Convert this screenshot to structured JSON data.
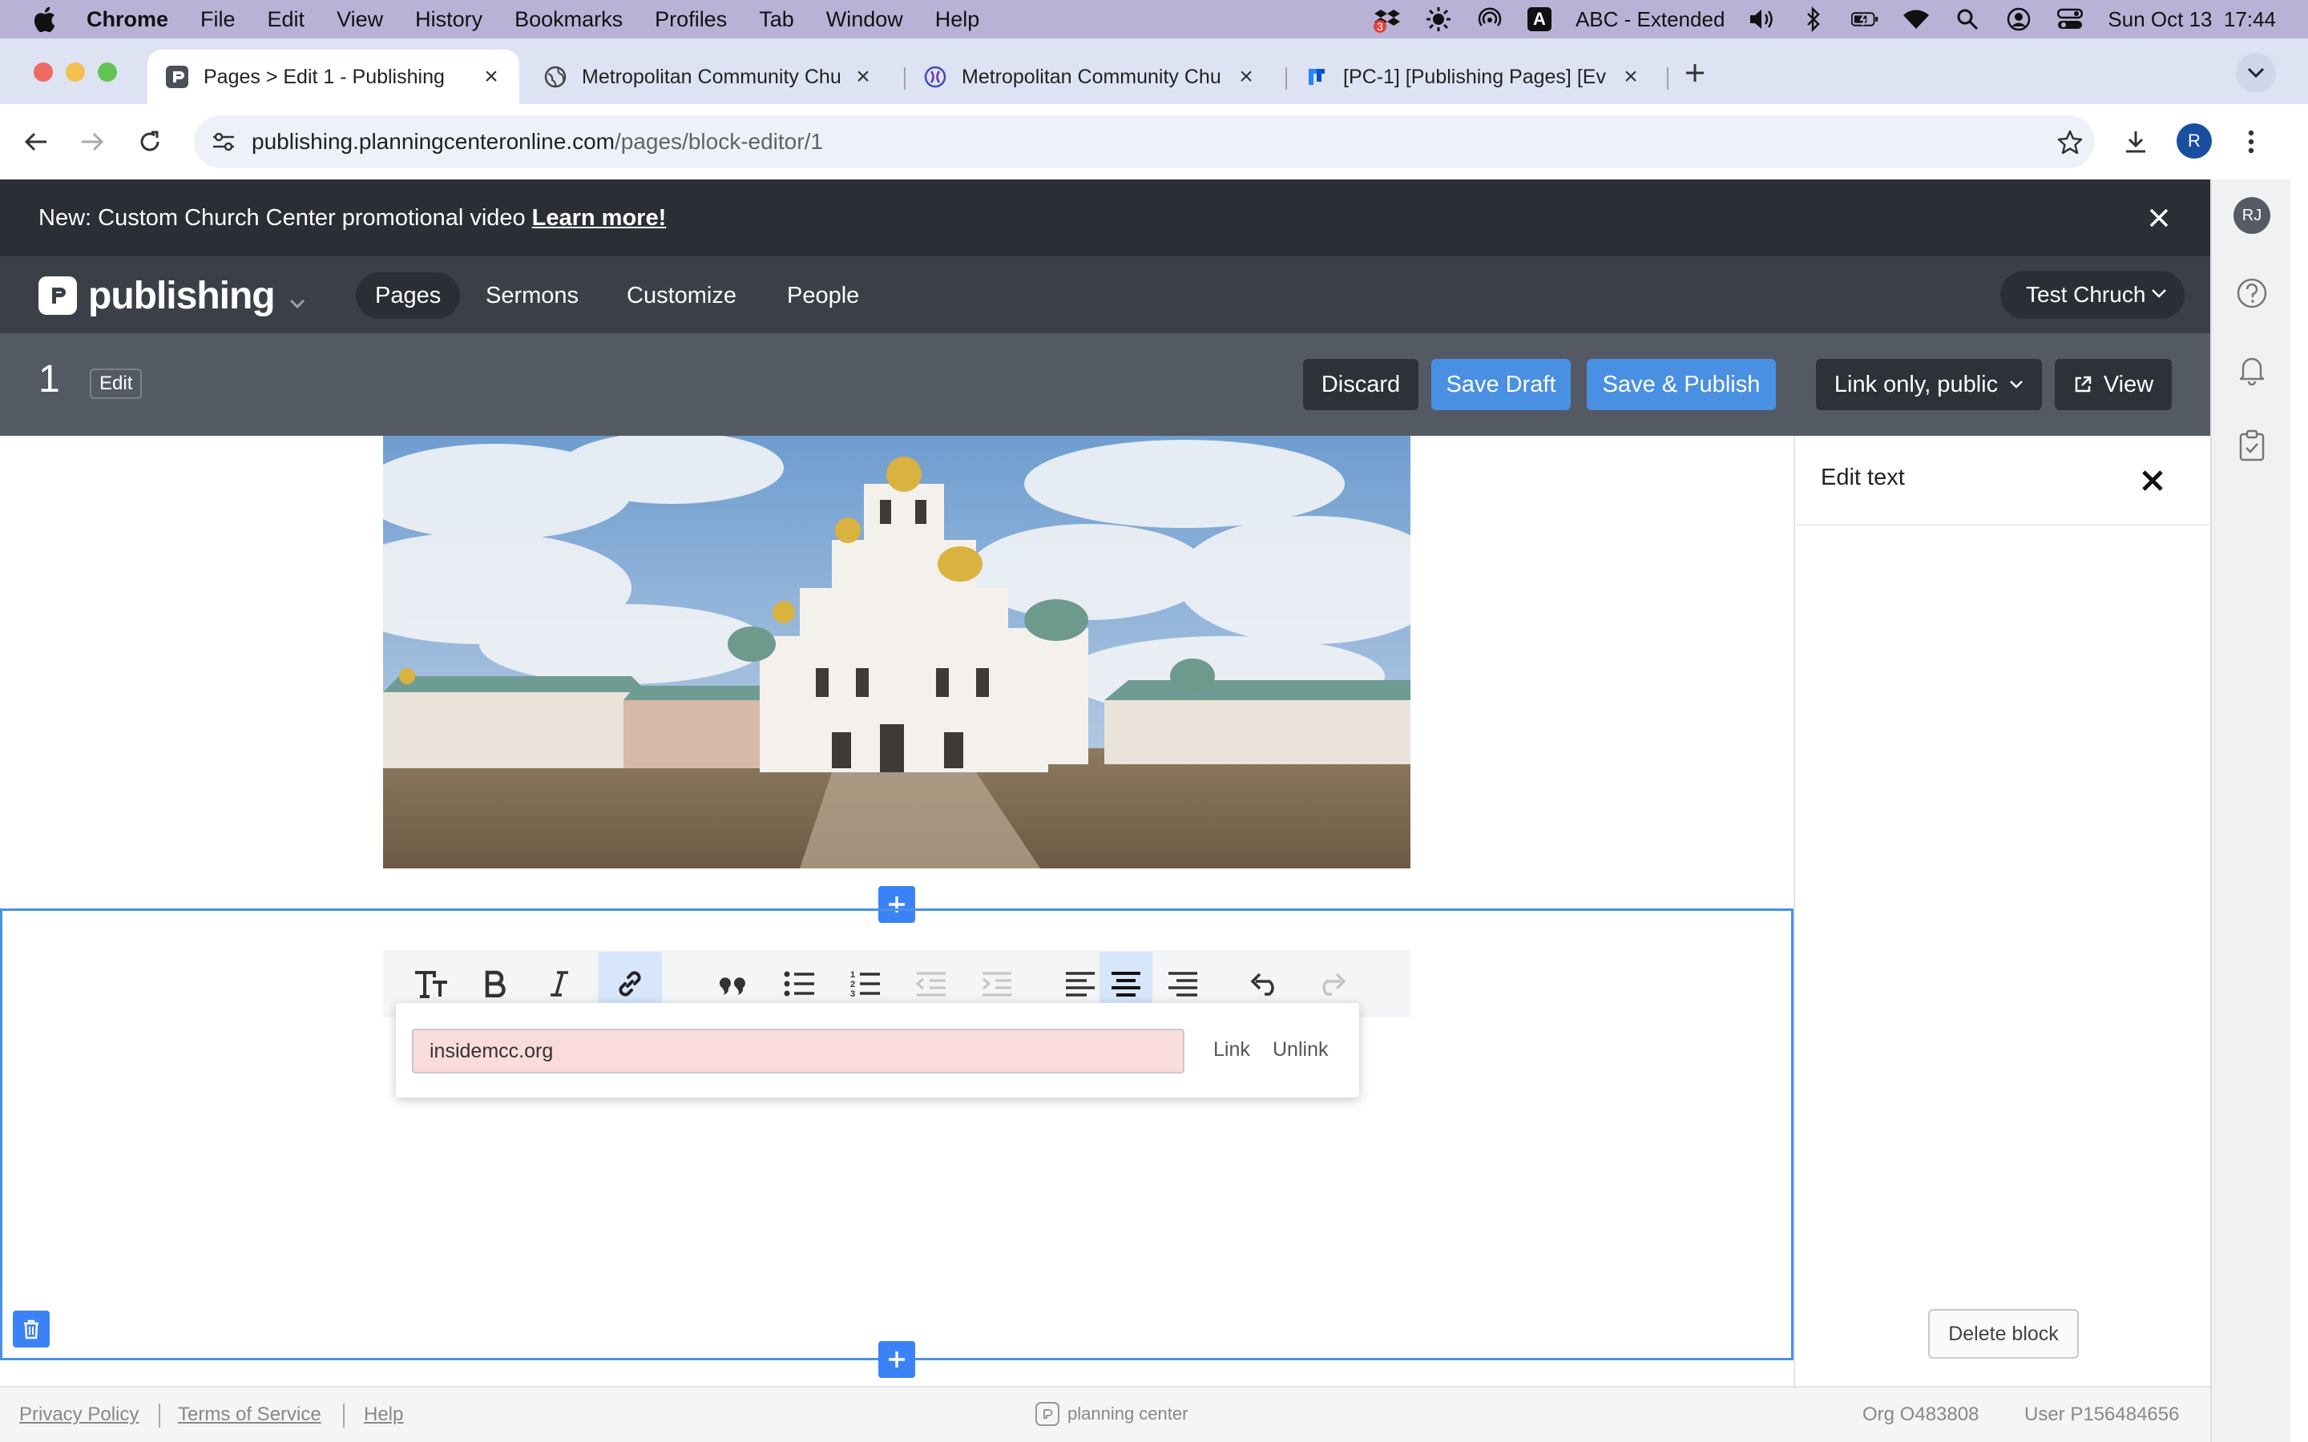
{
  "menubar": {
    "app_name": "Chrome",
    "items": [
      "File",
      "Edit",
      "View",
      "History",
      "Bookmarks",
      "Profiles",
      "Tab",
      "Window",
      "Help"
    ],
    "input_source": "ABC - Extended",
    "input_badge": "A",
    "datetime": "Sun Oct 13  17:44",
    "dropbox_badge": "3"
  },
  "browser": {
    "tabs": [
      {
        "title": "Pages > Edit 1 - Publishing",
        "active": true
      },
      {
        "title": "Metropolitan Community Chu",
        "active": false
      },
      {
        "title": "Metropolitan Community Chu",
        "active": false
      },
      {
        "title": "[PC-1] [Publishing Pages] [Ev",
        "active": false
      }
    ],
    "url_host": "publishing.planningcenteronline.com",
    "url_path": "/pages/block-editor/1",
    "profile_initial": "R"
  },
  "announcement": {
    "text": "New: Custom Church Center promotional video",
    "link": "Learn more!"
  },
  "app": {
    "product": "publishing",
    "nav": [
      "Pages",
      "Sermons",
      "Customize",
      "People"
    ],
    "active_nav": "Pages",
    "org": "Test Chruch",
    "user_initials": "RJ"
  },
  "page_bar": {
    "title": "1",
    "edit_badge": "Edit",
    "discard": "Discard",
    "save_draft": "Save Draft",
    "save_publish": "Save & Publish",
    "visibility": "Link only, public",
    "view": "View"
  },
  "editor": {
    "link_popup": {
      "value": "insidemcc.org",
      "link_label": "Link",
      "unlink_label": "Unlink"
    },
    "toolbar_icons": [
      "text-size-icon",
      "bold-icon",
      "italic-icon",
      "link-icon",
      "quote-icon",
      "bullet-list-icon",
      "numbered-list-icon",
      "outdent-icon",
      "indent-icon",
      "align-left-icon",
      "align-center-icon",
      "align-right-icon",
      "undo-icon",
      "redo-icon"
    ]
  },
  "side_panel": {
    "title": "Edit text",
    "delete_block": "Delete block"
  },
  "footer": {
    "privacy": "Privacy Policy",
    "terms": "Terms of Service",
    "help": "Help",
    "brand": "planning center",
    "org_id": "Org O483808",
    "user_id": "User P156484656"
  },
  "colors": {
    "accent": "#4a90e2",
    "nav_bg": "#3b4048",
    "announce_bg": "#2b2f35",
    "link_input_bg": "#fbdcdc"
  }
}
